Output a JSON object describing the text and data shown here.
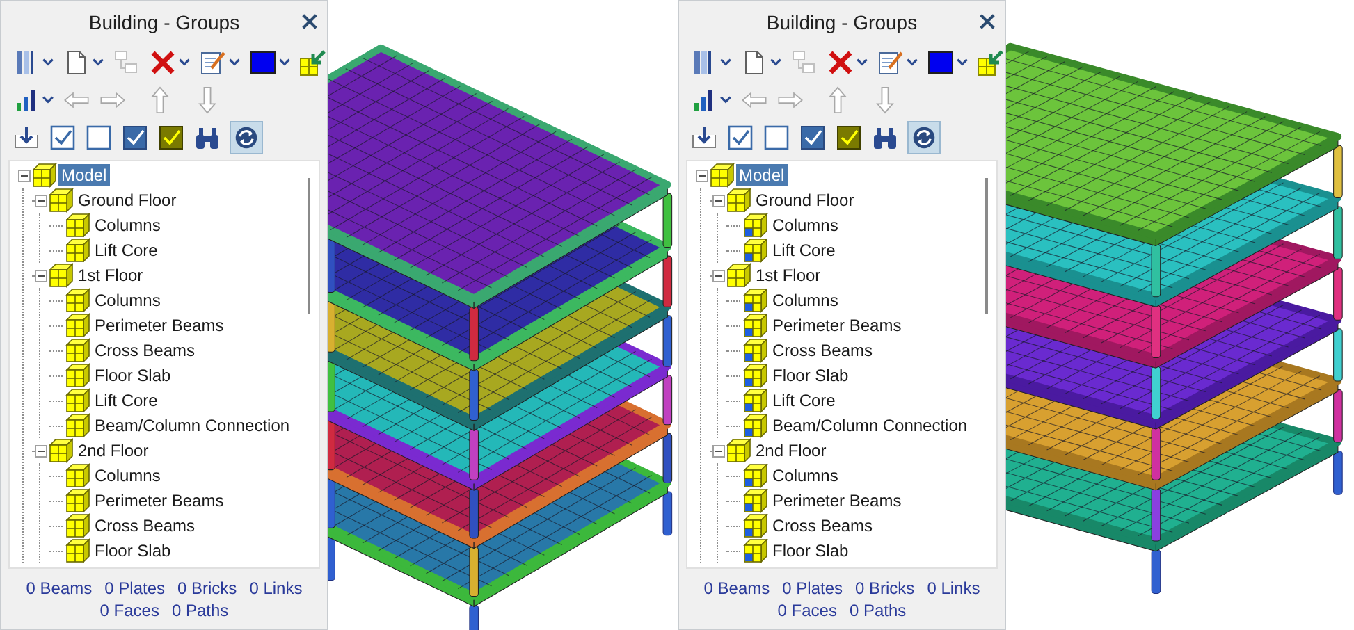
{
  "views": [
    {
      "panel": {
        "title": "Building - Groups",
        "sync_button": {
          "on": true
        },
        "tree": [
          {
            "label": "Model",
            "selected": true,
            "expanded": true,
            "colored": false,
            "children": [
              {
                "label": "Ground Floor",
                "selected": false,
                "expanded": true,
                "colored": false,
                "children": [
                  {
                    "label": "Columns",
                    "selected": false,
                    "colored": false
                  },
                  {
                    "label": "Lift Core",
                    "selected": false,
                    "colored": false
                  }
                ]
              },
              {
                "label": "1st Floor",
                "selected": false,
                "expanded": true,
                "colored": false,
                "children": [
                  {
                    "label": "Columns",
                    "selected": false,
                    "colored": false
                  },
                  {
                    "label": "Perimeter Beams",
                    "selected": false,
                    "colored": false
                  },
                  {
                    "label": "Cross Beams",
                    "selected": false,
                    "colored": false
                  },
                  {
                    "label": "Floor Slab",
                    "selected": false,
                    "colored": false
                  },
                  {
                    "label": "Lift Core",
                    "selected": false,
                    "colored": false
                  },
                  {
                    "label": "Beam/Column Connection",
                    "selected": false,
                    "colored": false
                  }
                ]
              },
              {
                "label": "2nd Floor",
                "selected": false,
                "expanded": true,
                "colored": false,
                "children": [
                  {
                    "label": "Columns",
                    "selected": false,
                    "colored": false
                  },
                  {
                    "label": "Perimeter Beams",
                    "selected": false,
                    "colored": false
                  },
                  {
                    "label": "Cross Beams",
                    "selected": false,
                    "colored": false
                  },
                  {
                    "label": "Floor Slab",
                    "selected": false,
                    "colored": false
                  }
                ]
              }
            ]
          }
        ],
        "status_lines": [
          [
            "0 Beams",
            "0 Plates",
            "0 Bricks",
            "0 Links"
          ],
          [
            "0 Faces",
            "0 Paths"
          ]
        ]
      }
    },
    {
      "panel": {
        "title": "Building - Groups",
        "sync_button": {
          "on": true
        },
        "tree": [
          {
            "label": "Model",
            "selected": true,
            "expanded": true,
            "colored": false,
            "children": [
              {
                "label": "Ground Floor",
                "selected": false,
                "expanded": true,
                "colored": false,
                "children": [
                  {
                    "label": "Columns",
                    "selected": false,
                    "colored": true
                  },
                  {
                    "label": "Lift Core",
                    "selected": false,
                    "colored": true
                  }
                ]
              },
              {
                "label": "1st Floor",
                "selected": false,
                "expanded": true,
                "colored": false,
                "children": [
                  {
                    "label": "Columns",
                    "selected": false,
                    "colored": true
                  },
                  {
                    "label": "Perimeter Beams",
                    "selected": false,
                    "colored": true
                  },
                  {
                    "label": "Cross Beams",
                    "selected": false,
                    "colored": true
                  },
                  {
                    "label": "Floor Slab",
                    "selected": false,
                    "colored": true
                  },
                  {
                    "label": "Lift Core",
                    "selected": false,
                    "colored": true
                  },
                  {
                    "label": "Beam/Column Connection",
                    "selected": false,
                    "colored": true
                  }
                ]
              },
              {
                "label": "2nd Floor",
                "selected": false,
                "expanded": true,
                "colored": false,
                "children": [
                  {
                    "label": "Columns",
                    "selected": false,
                    "colored": true
                  },
                  {
                    "label": "Perimeter Beams",
                    "selected": false,
                    "colored": true
                  },
                  {
                    "label": "Cross Beams",
                    "selected": false,
                    "colored": true
                  },
                  {
                    "label": "Floor Slab",
                    "selected": false,
                    "colored": true
                  }
                ]
              }
            ]
          }
        ],
        "status_lines": [
          [
            "0 Beams",
            "0 Plates",
            "0 Bricks",
            "0 Links"
          ],
          [
            "0 Faces",
            "0 Paths"
          ]
        ]
      }
    }
  ]
}
